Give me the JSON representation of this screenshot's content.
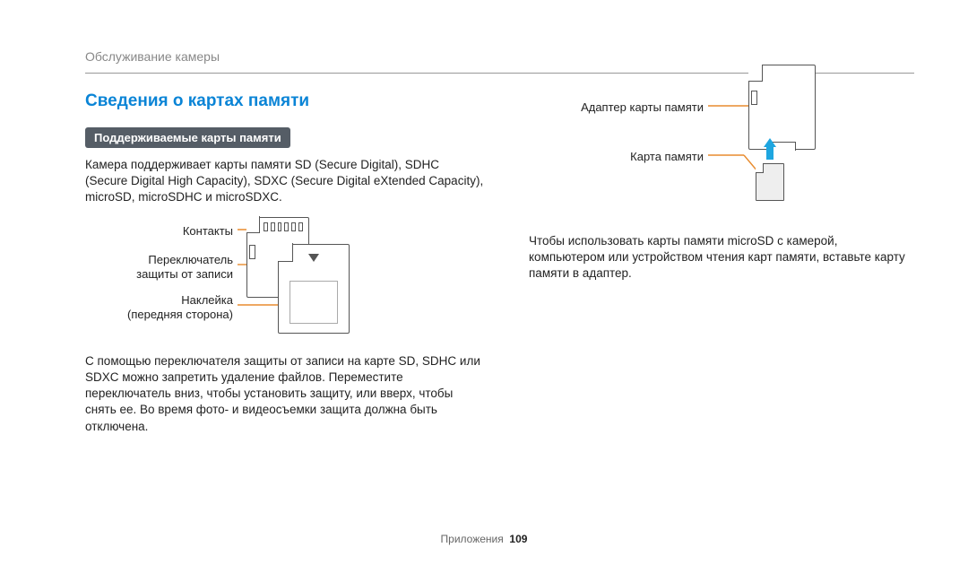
{
  "running_head": "Обслуживание камеры",
  "section_title": "Сведения о картах памяти",
  "subsection_pill": "Поддерживаемые карты памяти",
  "left_p1": "Камера поддерживает карты памяти SD (Secure Digital), SDHC (Secure Digital High Capacity), SDXC (Secure Digital eXtended Capacity), microSD, microSDHC и microSDXC.",
  "left_p2": "С помощью переключателя защиты от записи на карте SD, SDHC или SDXC можно запретить удаление файлов. Переместите переключатель вниз, чтобы установить защиту, или вверх, чтобы снять ее. Во время фото- и видеосъемки защита должна быть отключена.",
  "sd_labels": {
    "contacts": "Контакты",
    "switch_l1": "Переключатель",
    "switch_l2": "защиты от записи",
    "sticker_l1": "Наклейка",
    "sticker_l2": "(передняя сторона)"
  },
  "adapter_labels": {
    "adapter": "Адаптер карты памяти",
    "card": "Карта памяти"
  },
  "right_p1": "Чтобы использовать карты памяти microSD с камерой, компьютером или устройством чтения карт памяти, вставьте карту памяти в адаптер.",
  "footer_section": "Приложения",
  "footer_page": "109"
}
